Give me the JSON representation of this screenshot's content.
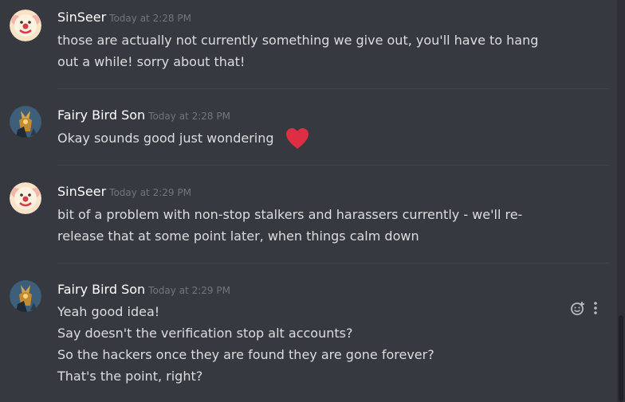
{
  "messages": [
    {
      "author": "SinSeer",
      "timestamp": "Today at 2:28 PM",
      "avatar": "clown-avatar",
      "lines": [
        "those are actually not currently something we give out, you'll have to hang",
        "out a while! sorry about that!"
      ]
    },
    {
      "author": "Fairy Bird Son",
      "timestamp": "Today at 2:28 PM",
      "avatar": "bird-avatar",
      "lines": [
        "Okay sounds good just wondering"
      ],
      "emoji": "heart-emoji"
    },
    {
      "author": "SinSeer",
      "timestamp": "Today at 2:29 PM",
      "avatar": "clown-avatar",
      "lines": [
        "bit of a problem with non-stop stalkers and harassers currently - we'll re-",
        "release that at some point later, when things calm down"
      ]
    },
    {
      "author": "Fairy Bird Son",
      "timestamp": "Today at 2:29 PM",
      "avatar": "bird-avatar",
      "lines": [
        "Yeah good idea!",
        "Say doesn't the verification stop alt accounts?",
        "So the hackers once they are found they are gone forever?",
        "That's the point, right?"
      ]
    }
  ],
  "colors": {
    "background": "#36393f",
    "author": "#ffffff",
    "text": "#dcddde",
    "timestamp": "#72767d",
    "heart": "#dd2e44"
  },
  "icons": {
    "add_reaction": "add-reaction-icon",
    "more": "more-options-icon"
  }
}
